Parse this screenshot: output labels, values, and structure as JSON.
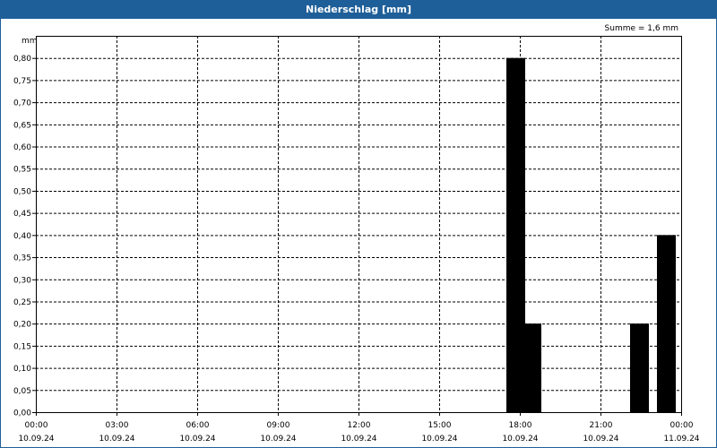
{
  "window": {
    "title": "Niederschlag [mm]"
  },
  "chart_data": {
    "type": "bar",
    "title": "Niederschlag [mm]",
    "unit_label": "mm",
    "sum_label": "Summe = 1,6 mm",
    "xlabel": "",
    "ylabel": "",
    "ylim": [
      0,
      0.85
    ],
    "y_ticks": [
      "0,00",
      "0,05",
      "0,10",
      "0,15",
      "0,20",
      "0,25",
      "0,30",
      "0,35",
      "0,40",
      "0,45",
      "0,50",
      "0,55",
      "0,60",
      "0,65",
      "0,70",
      "0,75",
      "0,80"
    ],
    "y_tick_values": [
      0,
      0.05,
      0.1,
      0.15,
      0.2,
      0.25,
      0.3,
      0.35,
      0.4,
      0.45,
      0.5,
      0.55,
      0.6,
      0.65,
      0.7,
      0.75,
      0.8
    ],
    "x_range_hours": [
      0,
      24
    ],
    "x_ticks": [
      {
        "hour": 0,
        "time": "00:00",
        "date": "10.09.24"
      },
      {
        "hour": 3,
        "time": "03:00",
        "date": "10.09.24"
      },
      {
        "hour": 6,
        "time": "06:00",
        "date": "10.09.24"
      },
      {
        "hour": 9,
        "time": "09:00",
        "date": "10.09.24"
      },
      {
        "hour": 12,
        "time": "12:00",
        "date": "10.09.24"
      },
      {
        "hour": 15,
        "time": "15:00",
        "date": "10.09.24"
      },
      {
        "hour": 18,
        "time": "18:00",
        "date": "10.09.24"
      },
      {
        "hour": 21,
        "time": "21:00",
        "date": "10.09.24"
      },
      {
        "hour": 24,
        "time": "00:00",
        "date": "11.09.24"
      }
    ],
    "bars": [
      {
        "start_hour": 17.5,
        "end_hour": 18.2,
        "value": 0.8
      },
      {
        "start_hour": 18.1,
        "end_hour": 18.8,
        "value": 0.2
      },
      {
        "start_hour": 22.1,
        "end_hour": 22.8,
        "value": 0.2
      },
      {
        "start_hour": 23.1,
        "end_hour": 23.8,
        "value": 0.4
      }
    ],
    "grid": true,
    "bar_color": "#000000"
  }
}
